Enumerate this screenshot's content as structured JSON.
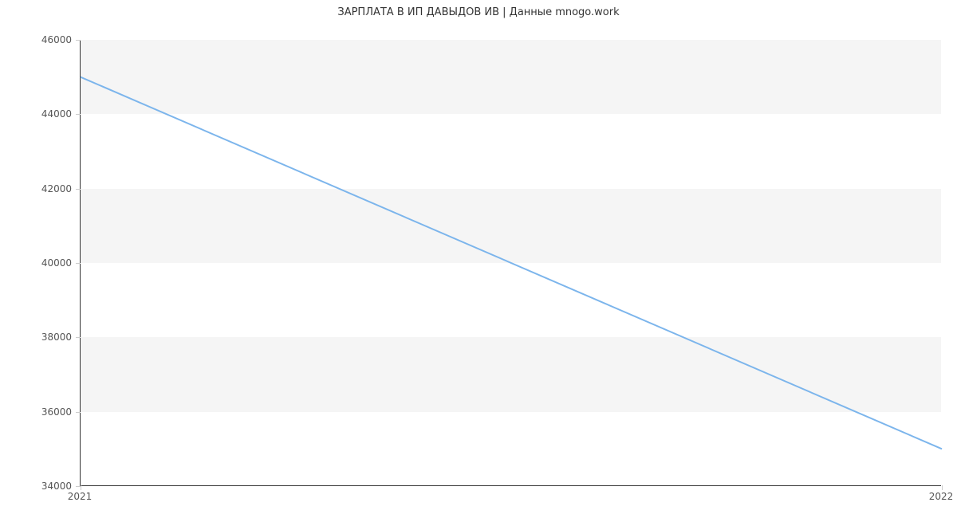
{
  "chart_data": {
    "type": "line",
    "title": "ЗАРПЛАТА В ИП ДАВЫДОВ ИВ | Данные mnogo.work",
    "xlabel": "",
    "ylabel": "",
    "x": [
      "2021",
      "2022"
    ],
    "values": [
      45000,
      35000
    ],
    "ylim": [
      34000,
      46000
    ],
    "y_ticks": [
      34000,
      36000,
      38000,
      40000,
      42000,
      44000,
      46000
    ],
    "x_ticks": [
      "2021",
      "2022"
    ],
    "line_color": "#7cb5ec",
    "band_color": "#f5f5f5",
    "grid": false,
    "legend": false
  }
}
